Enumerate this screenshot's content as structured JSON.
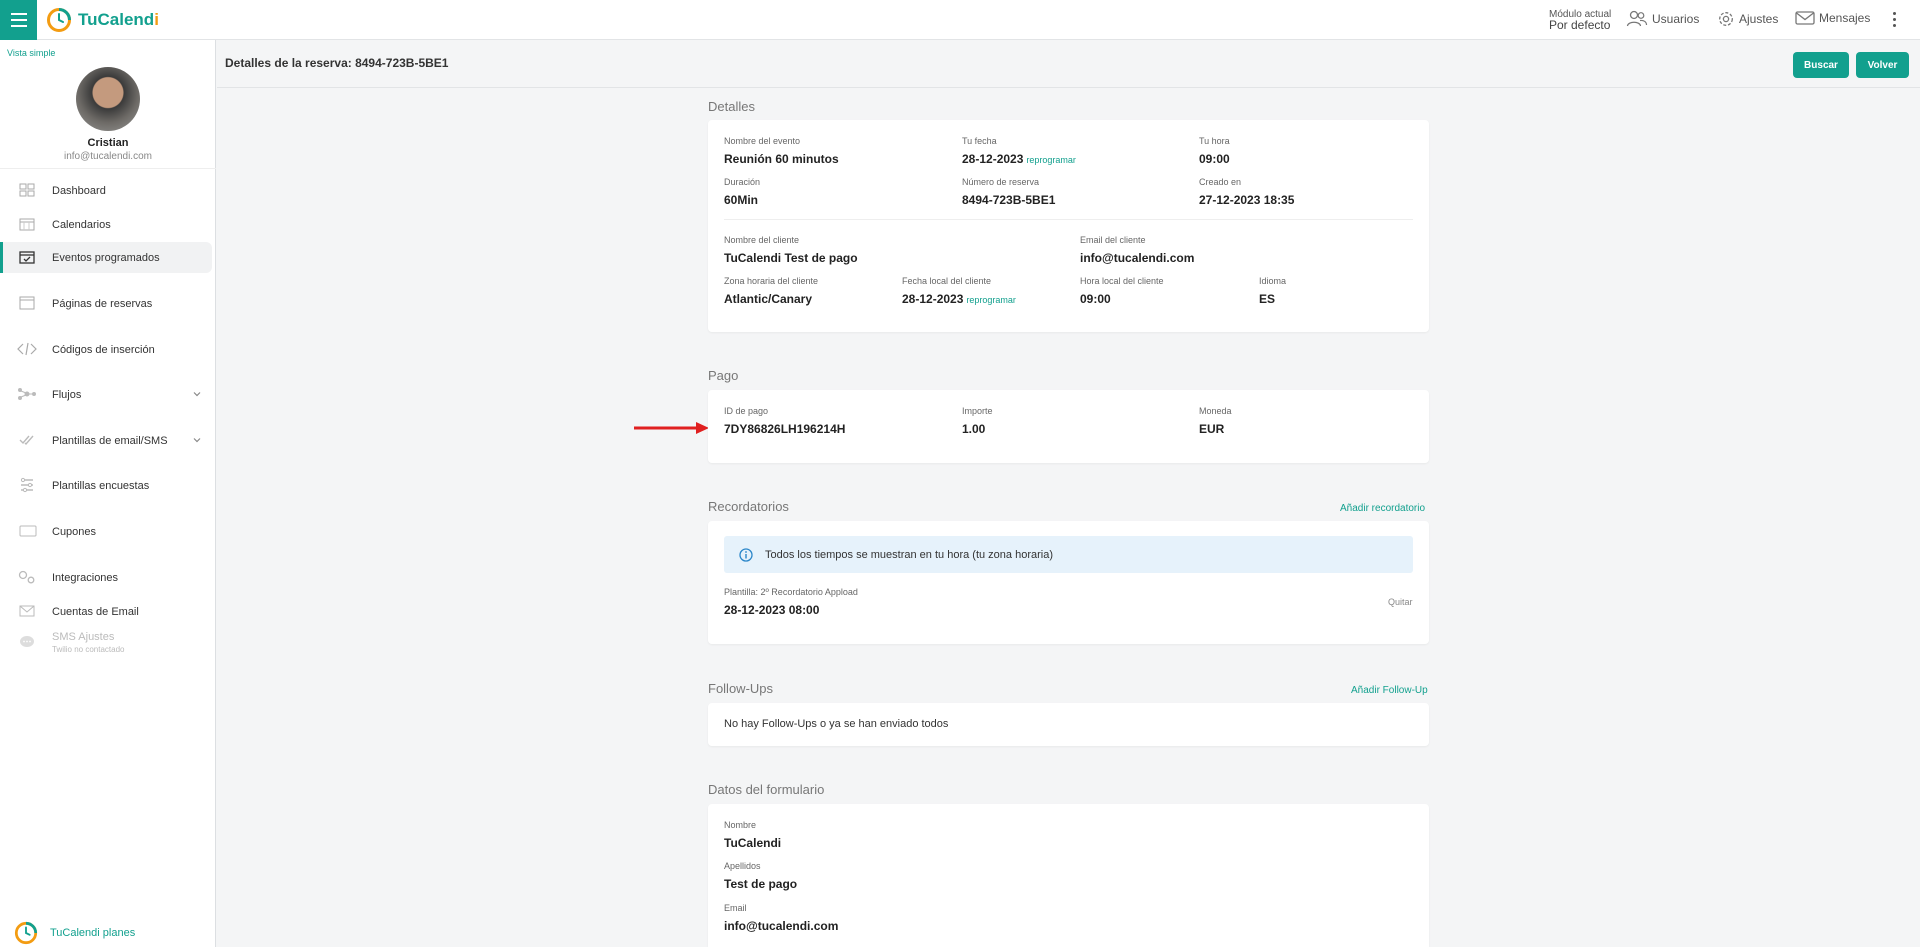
{
  "topbar": {
    "brand_a": "TuCalend",
    "brand_b": "i",
    "modulo_label": "Módulo actual",
    "modulo_value": "Por defecto",
    "usuarios": "Usuarios",
    "ajustes": "Ajustes",
    "mensajes": "Mensajes"
  },
  "sidebar": {
    "vista": "Vista simple",
    "user_name": "Cristian",
    "user_email": "info@tucalendi.com",
    "items": [
      {
        "label": "Dashboard",
        "icon": "grid-icon"
      },
      {
        "label": "Calendarios",
        "icon": "calendar-icon"
      },
      {
        "label": "Eventos programados",
        "icon": "calendar-check-icon"
      },
      {
        "label": "Páginas de reservas",
        "icon": "window-icon"
      },
      {
        "label": "Códigos de inserción",
        "icon": "code-icon"
      },
      {
        "label": "Flujos",
        "icon": "flow-icon"
      },
      {
        "label": "Plantillas de email/SMS",
        "icon": "check-double-icon"
      },
      {
        "label": "Plantillas encuestas",
        "icon": "survey-icon"
      },
      {
        "label": "Cupones",
        "icon": "ticket-icon"
      },
      {
        "label": "Integraciones",
        "icon": "gears-icon"
      },
      {
        "label": "Cuentas de Email",
        "icon": "mail-icon"
      },
      {
        "label": "SMS Ajustes",
        "icon": "chat-icon"
      }
    ],
    "sms_sub": "Twilio no contactado",
    "planes": "TuCalendi planes"
  },
  "header": {
    "title": "Detalles de la reserva: 8494-723B-5BE1",
    "buscar": "Buscar",
    "volver": "Volver"
  },
  "detalles": {
    "title": "Detalles",
    "nombre_evento_k": "Nombre del evento",
    "nombre_evento_v": "Reunión 60 minutos",
    "tu_fecha_k": "Tu fecha",
    "tu_fecha_v": "28-12-2023",
    "reprogramar": "reprogramar",
    "tu_hora_k": "Tu hora",
    "tu_hora_v": "09:00",
    "duracion_k": "Duración",
    "duracion_v": "60Min",
    "numero_k": "Número de reserva",
    "numero_v": "8494-723B-5BE1",
    "creado_k": "Creado en",
    "creado_v": "27-12-2023 18:35",
    "cliente_k": "Nombre del cliente",
    "cliente_v": "TuCalendi Test de pago",
    "email_k": "Email del cliente",
    "email_v": "info@tucalendi.com",
    "zona_k": "Zona horaria del cliente",
    "zona_v": "Atlantic/Canary",
    "fecha_local_k": "Fecha local del cliente",
    "fecha_local_v": "28-12-2023",
    "hora_local_k": "Hora local del cliente",
    "hora_local_v": "09:00",
    "idioma_k": "Idioma",
    "idioma_v": "ES"
  },
  "pago": {
    "title": "Pago",
    "id_k": "ID de pago",
    "id_v": "7DY86826LH196214H",
    "importe_k": "Importe",
    "importe_v": "1.00",
    "moneda_k": "Moneda",
    "moneda_v": "EUR"
  },
  "recordatorios": {
    "title": "Recordatorios",
    "add": "Añadir recordatorio",
    "info": "Todos los tiempos se muestran en tu hora (tu zona horaria)",
    "plantilla_k": "Plantilla: 2º Recordatorio Appload",
    "plantilla_v": "28-12-2023 08:00",
    "quitar": "Quitar"
  },
  "followups": {
    "title": "Follow-Ups",
    "add": "Añadir Follow-Up",
    "empty": "No hay Follow-Ups o ya se han enviado todos"
  },
  "formulario": {
    "title": "Datos del formulario",
    "nombre_k": "Nombre",
    "nombre_v": "TuCalendi",
    "apellidos_k": "Apellidos",
    "apellidos_v": "Test de pago",
    "email_k": "Email",
    "email_v": "info@tucalendi.com"
  },
  "colors": {
    "accent": "#12a08e",
    "logo_orange": "#f39c12",
    "annotation_arrow": "#e02020"
  }
}
